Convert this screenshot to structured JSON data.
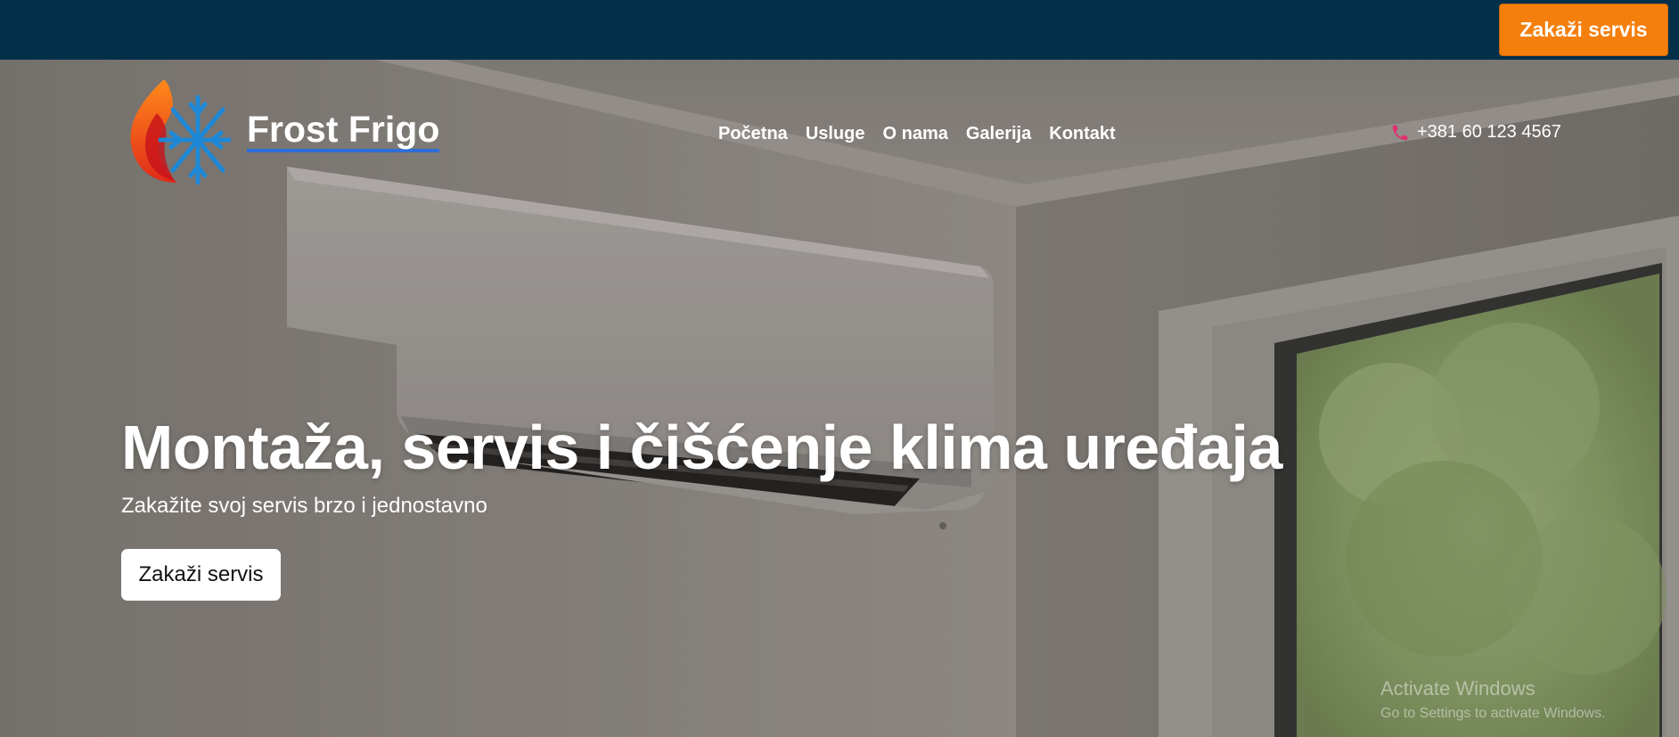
{
  "topbar": {
    "cta_label": "Zakaži servis",
    "background": "#02304b",
    "cta_color": "#f57f0c"
  },
  "brand": {
    "name": "Frost Frigo",
    "logo_icon": "flame-snowflake-logo",
    "underline_color": "#2c6ed6"
  },
  "nav": {
    "items": [
      {
        "label": "Početna"
      },
      {
        "label": "Usluge"
      },
      {
        "label": "O nama"
      },
      {
        "label": "Galerija"
      },
      {
        "label": "Kontakt"
      }
    ]
  },
  "contact": {
    "phone_icon": "phone-icon",
    "phone": "+381 60 123 4567"
  },
  "hero": {
    "title": "Montaža, servis i čišćenje klima uređaja",
    "subtitle": "Zakažite svoj servis brzo i jednostavno",
    "cta_label": "Zakaži servis",
    "background_image": "wall-mounted-air-conditioner-room"
  },
  "os_watermark": {
    "title": "Activate Windows",
    "subtitle": "Go to Settings to activate Windows."
  }
}
